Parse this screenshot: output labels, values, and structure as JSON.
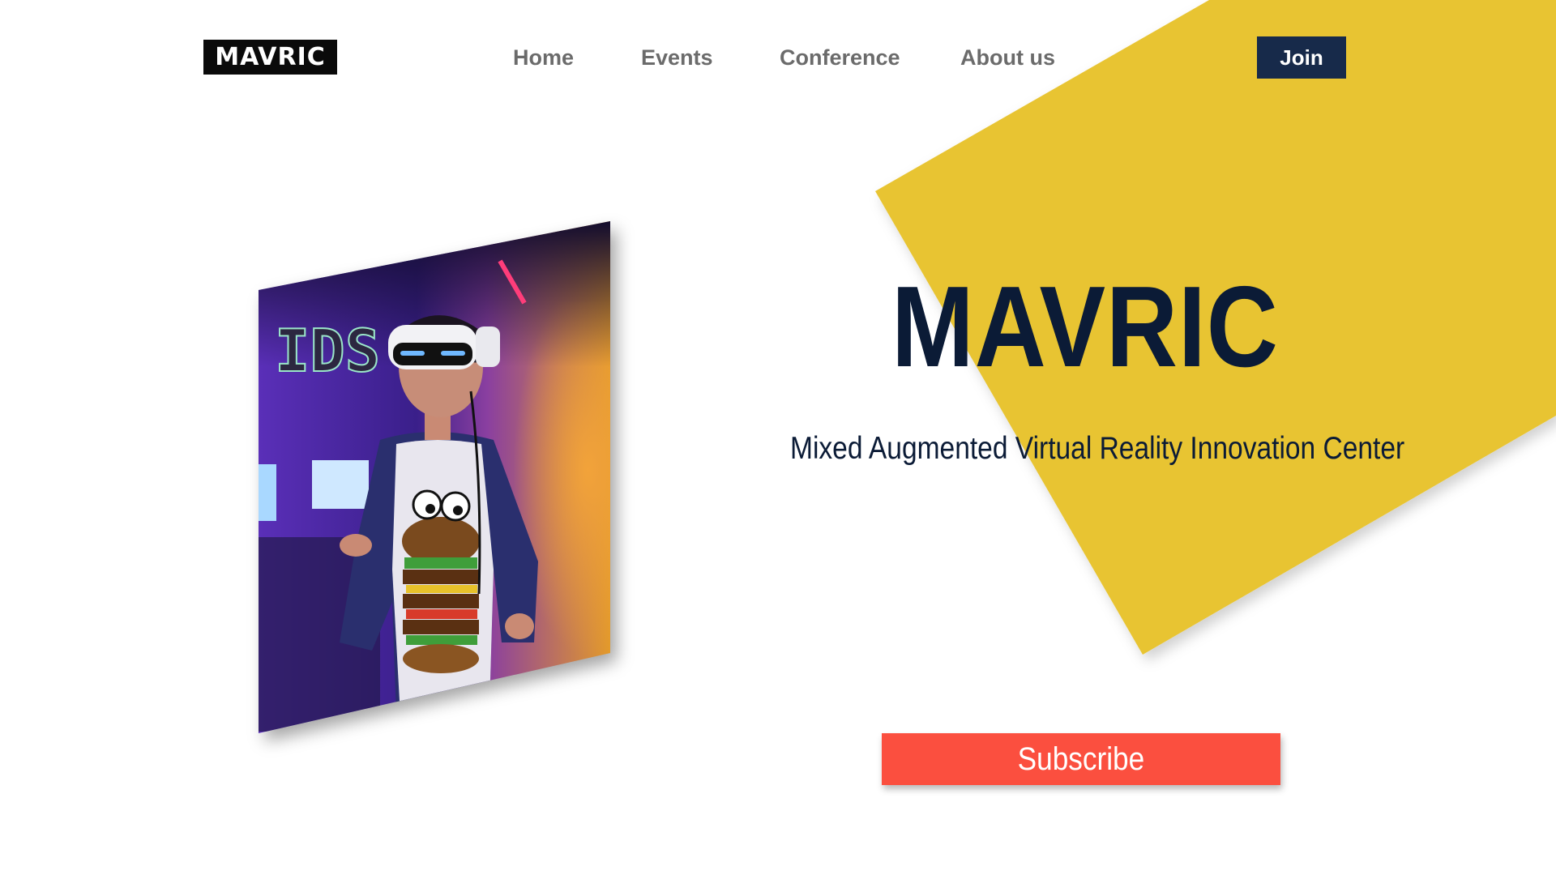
{
  "header": {
    "logo_text": "MAVRIC",
    "nav": [
      {
        "label": "Home"
      },
      {
        "label": "Events"
      },
      {
        "label": "Conference"
      },
      {
        "label": "About us"
      }
    ],
    "join_label": "Join"
  },
  "hero": {
    "title": "MAVRIC",
    "subtitle": "Mixed Augmented Virtual Reality Innovation Center",
    "subscribe_label": "Subscribe",
    "image_subject": "person wearing a VR headset in a dimly lit arcade"
  },
  "colors": {
    "accent_yellow": "#E8C433",
    "navy": "#172A4A",
    "title_navy": "#0B1B36",
    "subscribe_red": "#FB4F3F",
    "nav_gray": "#6B6B6B"
  },
  "icons": [
    "mavric-logo"
  ]
}
